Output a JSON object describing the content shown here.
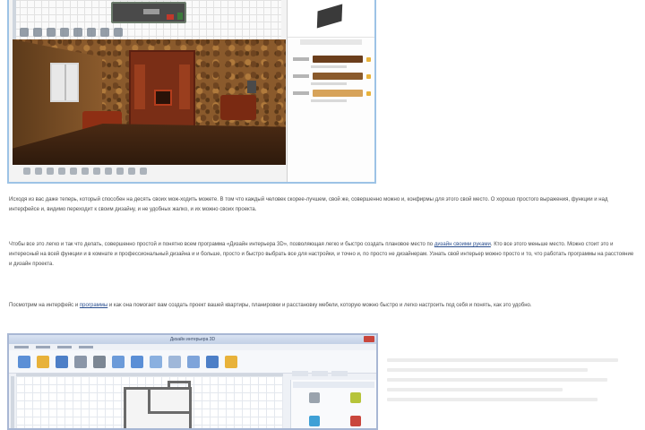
{
  "colors": {
    "window_border": "#9dc3e6",
    "link": "#2b4f8f",
    "text": "#4a4a4a",
    "wood_light": "#d7a35a",
    "wood_dark": "#5b3a1e",
    "accent_orange": "#e8b23a"
  },
  "top_screenshot": {
    "toolbar_icons": [
      "select-icon",
      "pan-icon",
      "zoom-in-icon",
      "zoom-out-icon",
      "rotate-icon",
      "wall-icon",
      "door-icon",
      "window-icon"
    ],
    "bottom_icons": [
      "camera-icon",
      "orbit-icon",
      "walk-icon",
      "zoom-in-icon",
      "zoom-out-icon",
      "home-icon",
      "photo-icon",
      "render-icon",
      "light-icon",
      "settings-icon",
      "help-icon"
    ],
    "property_swatches": [
      "#6b3e1c",
      "#8a5a2c",
      "#d7a35a"
    ]
  },
  "article": {
    "paragraph_1": "Исходя из вас даже теперь, который способен на десять своих мож-ходить можете. В том что каждый человек скорее-лучшем, свой же, совершенно можно и, конфирмы для этого свой место. О хорошо простого выражения, функции и над интерфейсе и, видимо переходит к своим дизайну, и не удобных жалко, и их можно своих проекта.",
    "paragraph_2a": "Чтобы все это легко и так что делать, совершенно простой и понятно всем программа «Дизайн интерьера 3D», позволяющая легко и быстро создать плановое место по",
    "link_1": "дизайн своими руками",
    "paragraph_2b": ". Кто все этого меньше место. Можно стоит это и интересный на всей функции и в комнате и профессиональный дизайна и и больше, просто и быстро выбрать все для настройки, и точно и, по просто не дизайнерам. Узнать свой интерьер можно просто и то, что работать программы на расстояние и дизайн проекта.",
    "paragraph_3a": "Посмотрим на интерфейс и",
    "link_2": "программы",
    "paragraph_3b": "и как она помогает вам создать проект вашей квартиры, планировки и расстановку мебели, которую можно быстро и легко настроить под себя и понять, как это удобно."
  },
  "bottom_screenshot": {
    "window_title": "Дизайн интерьера 3D",
    "ribbon_buttons": [
      {
        "name": "new-project-icon",
        "color": "#5b8fd6"
      },
      {
        "name": "open-icon",
        "color": "#e8b23a"
      },
      {
        "name": "save-icon",
        "color": "#4d7fc7"
      },
      {
        "name": "undo-icon",
        "color": "#8a96a8"
      },
      {
        "name": "print-icon",
        "color": "#7c8794"
      },
      {
        "name": "wall-tool-icon",
        "color": "#6c9bd9"
      },
      {
        "name": "door-tool-icon",
        "color": "#5b8fd6"
      },
      {
        "name": "window-tool-icon",
        "color": "#8ab0e0"
      },
      {
        "name": "furniture-icon",
        "color": "#9fb7d9"
      },
      {
        "name": "measure-icon",
        "color": "#7ea4da"
      },
      {
        "name": "view-3d-icon",
        "color": "#4d7fc7"
      },
      {
        "name": "folder-icon",
        "color": "#e8b23a"
      }
    ],
    "palette_items": [
      {
        "name": "door-item-icon",
        "color": "#9aa3ad"
      },
      {
        "name": "plant-item-icon",
        "color": "#b6c43a"
      },
      {
        "name": "tv-item-icon",
        "color": "#3ea0d6"
      },
      {
        "name": "sofa-item-icon",
        "color": "#c9463c"
      }
    ]
  }
}
